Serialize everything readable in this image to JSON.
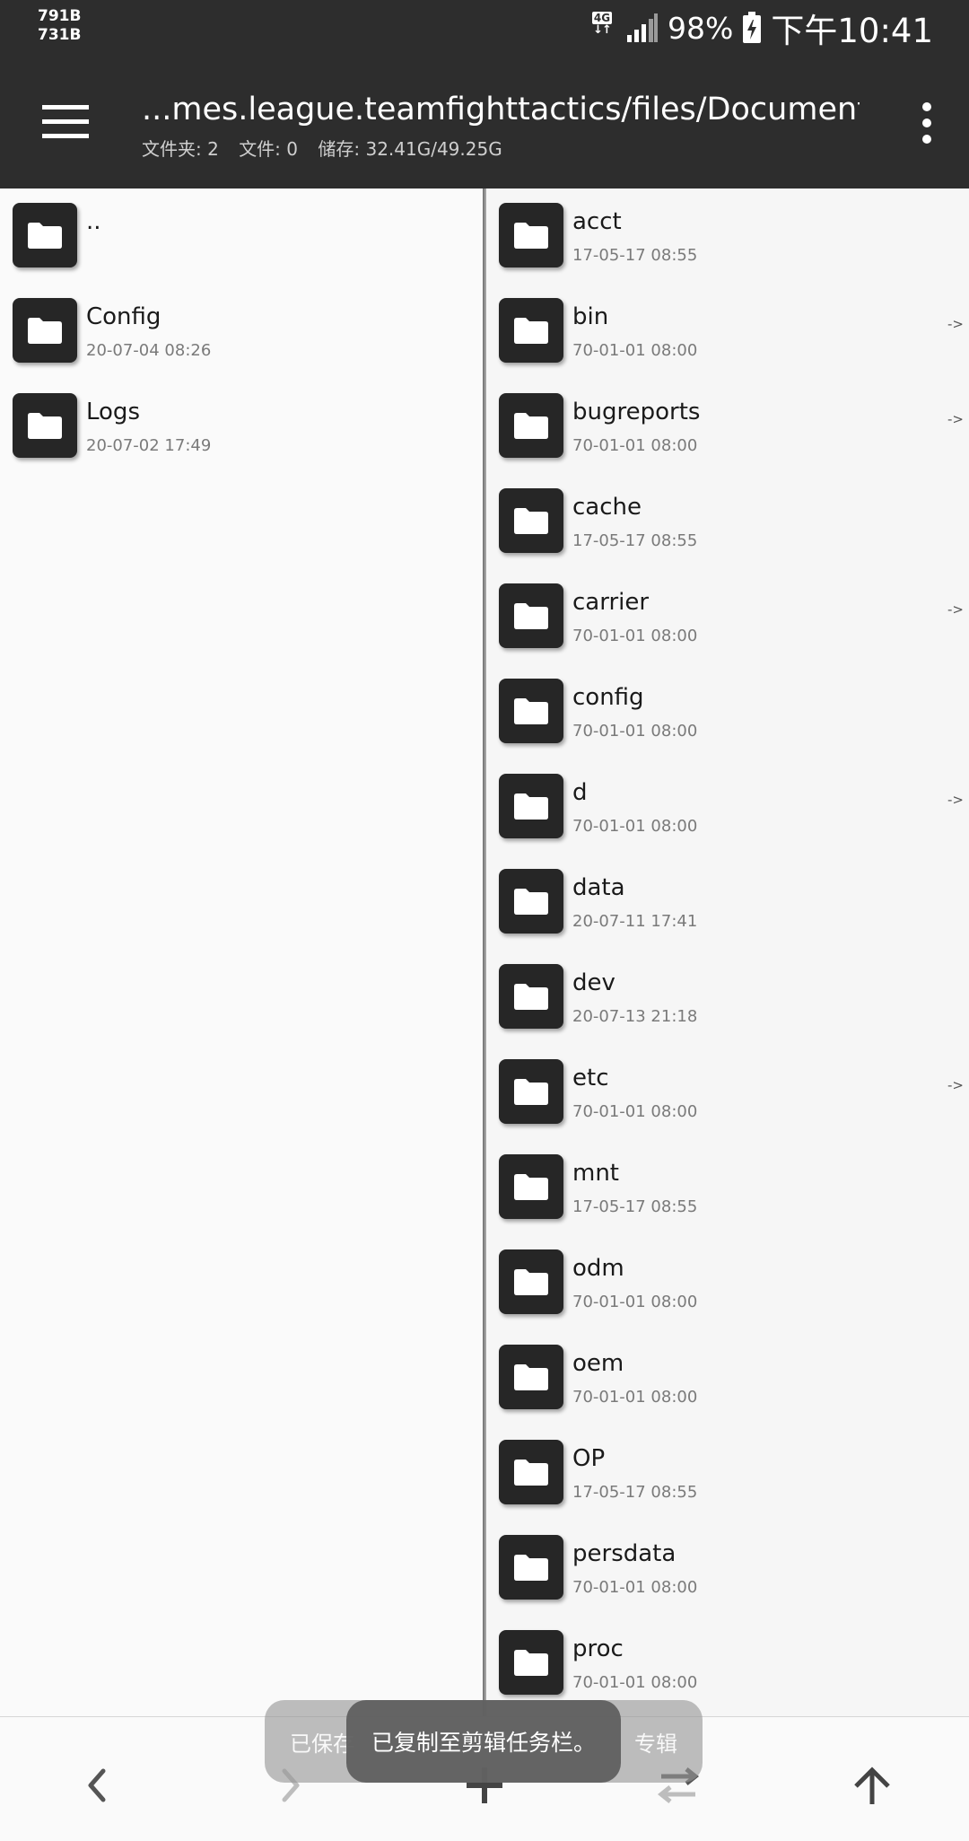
{
  "status_bar": {
    "net_up": "791B",
    "net_down": "731B",
    "network_label": "4G",
    "battery_percent": "98%",
    "time": "下午10:41"
  },
  "app_bar": {
    "title": "...mes.league.teamfighttactics/files/Documents/",
    "folders_info": "文件夹: 2",
    "files_info": "文件: 0",
    "storage_info": "储存: 32.41G/49.25G"
  },
  "left_pane": {
    "items": [
      {
        "name": "..",
        "date": ""
      },
      {
        "name": "Config",
        "date": "20-07-04 08:26"
      },
      {
        "name": "Logs",
        "date": "20-07-02 17:49"
      }
    ]
  },
  "right_pane": {
    "items": [
      {
        "name": "acct",
        "date": "17-05-17 08:55",
        "link": ""
      },
      {
        "name": "bin",
        "date": "70-01-01 08:00",
        "link": "->"
      },
      {
        "name": "bugreports",
        "date": "70-01-01 08:00",
        "link": "->"
      },
      {
        "name": "cache",
        "date": "17-05-17 08:55",
        "link": ""
      },
      {
        "name": "carrier",
        "date": "70-01-01 08:00",
        "link": "->"
      },
      {
        "name": "config",
        "date": "70-01-01 08:00",
        "link": ""
      },
      {
        "name": "d",
        "date": "70-01-01 08:00",
        "link": "->"
      },
      {
        "name": "data",
        "date": "20-07-11 17:41",
        "link": ""
      },
      {
        "name": "dev",
        "date": "20-07-13 21:18",
        "link": ""
      },
      {
        "name": "etc",
        "date": "70-01-01 08:00",
        "link": "->"
      },
      {
        "name": "mnt",
        "date": "17-05-17 08:55",
        "link": ""
      },
      {
        "name": "odm",
        "date": "70-01-01 08:00",
        "link": ""
      },
      {
        "name": "oem",
        "date": "70-01-01 08:00",
        "link": ""
      },
      {
        "name": "OP",
        "date": "17-05-17 08:55",
        "link": ""
      },
      {
        "name": "persdata",
        "date": "70-01-01 08:00",
        "link": ""
      },
      {
        "name": "proc",
        "date": "70-01-01 08:00",
        "link": ""
      }
    ]
  },
  "toasts": {
    "back_left": "已保存",
    "back_right": "专辑",
    "front": "已复制至剪辑任务栏。"
  },
  "bottom_bar": {
    "icons": [
      "chevron-left-icon",
      "chevron-right-icon",
      "plus-icon",
      "swap-icon",
      "arrow-up-icon"
    ]
  },
  "colors": {
    "bar_background": "#2d2d2d",
    "folder_icon": "#262626",
    "pane_background": "#fafafa"
  }
}
